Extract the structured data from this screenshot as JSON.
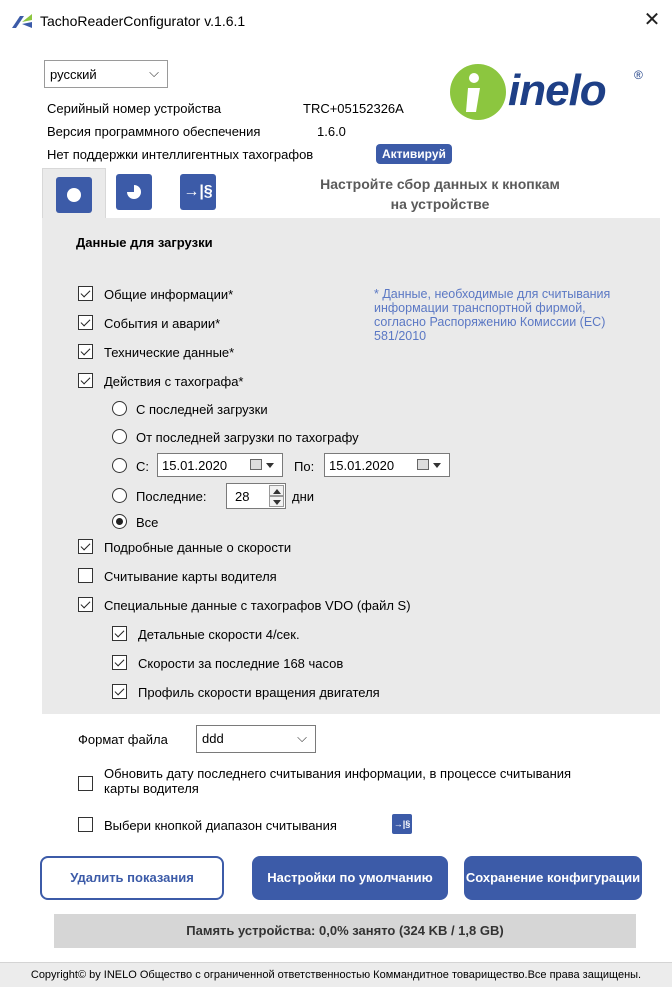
{
  "window": {
    "title": "TachoReaderConfigurator v.1.6.1",
    "close_glyph": "✕"
  },
  "language": {
    "selected": "русский"
  },
  "device": {
    "serial_label": "Серийный номер устройства",
    "serial_value": "TRC+05152326A",
    "firmware_label": "Версия программного обеспечения",
    "firmware_value": "1.6.0",
    "smart_label": "Нет поддержки интеллигентных тахографов",
    "activate_label": "Активируй"
  },
  "brand": {
    "name": "inelo",
    "reg": "®",
    "color": "#1e3f86",
    "accent": "#8cc63f"
  },
  "tabs": [
    {
      "icon": "circle-icon",
      "active": true
    },
    {
      "icon": "half-moon-icon",
      "active": false
    },
    {
      "icon": "range-arrow-icon",
      "glyph": "→|§",
      "active": false
    }
  ],
  "config_note": "Настройте сбор данных к кнопкам на устройстве",
  "panel": {
    "title": "Данные для загрузки",
    "note": "* Данные, необходимые для считывания информации транспортной фирмой, согласно Распоряжению Комиссии (ЕС) 581/2010",
    "options": {
      "general": {
        "label": "Общие информации*",
        "checked": true
      },
      "events": {
        "label": "События и аварии*",
        "checked": true
      },
      "technical": {
        "label": "Технические данные*",
        "checked": true
      },
      "activities": {
        "label": "Действия с тахографа*",
        "checked": true
      },
      "detailed_speed": {
        "label": "Подробные данные о скорости",
        "checked": true
      },
      "driver_card": {
        "label": "Считывание карты водителя",
        "checked": false
      },
      "vdo_special": {
        "label": "Специальные данные с тахографов VDO (файл S)",
        "checked": true
      },
      "detail_speeds": {
        "label": "Детальные скорости 4/сек.",
        "checked": true
      },
      "speeds_168": {
        "label": "Скорости за последние 168 часов",
        "checked": true
      },
      "rpm_profile": {
        "label": "Профиль скорости вращения двигателя",
        "checked": true
      }
    },
    "range": {
      "since_last": "С последней загрузки",
      "since_last_tacho": "От последней загрузки по тахографу",
      "from_label": "С:",
      "from_date": "15.01.2020",
      "to_label": "По:",
      "to_date": "15.01.2020",
      "last_label": "Последние:",
      "last_value": "28",
      "days_label": "дни",
      "all_label": "Все",
      "selected": "all"
    }
  },
  "file_format": {
    "label": "Формат файла",
    "value": "ddd"
  },
  "update_date": {
    "label": "Обновить дату последнего считывания информации, в процессе считывания карты водителя",
    "checked": false
  },
  "choose_range": {
    "label": "Выбери кнопкой диапазон считывания",
    "checked": false,
    "icon_glyph": "→|§"
  },
  "buttons": {
    "delete": "Удалить показания",
    "defaults": "Настройки по умолчанию",
    "save": "Сохранение конфигурации"
  },
  "memory": "Память устройства: 0,0% занято (324 KB / 1,8 GB)",
  "footer": "Copyright© by INELO Общество с ограниченной ответственностью Коммандитное товарищество.Все права защищены.",
  "colors": {
    "accent": "#3c5ba8",
    "note": "#5b78c4",
    "panel_bg": "#eaeaea"
  }
}
